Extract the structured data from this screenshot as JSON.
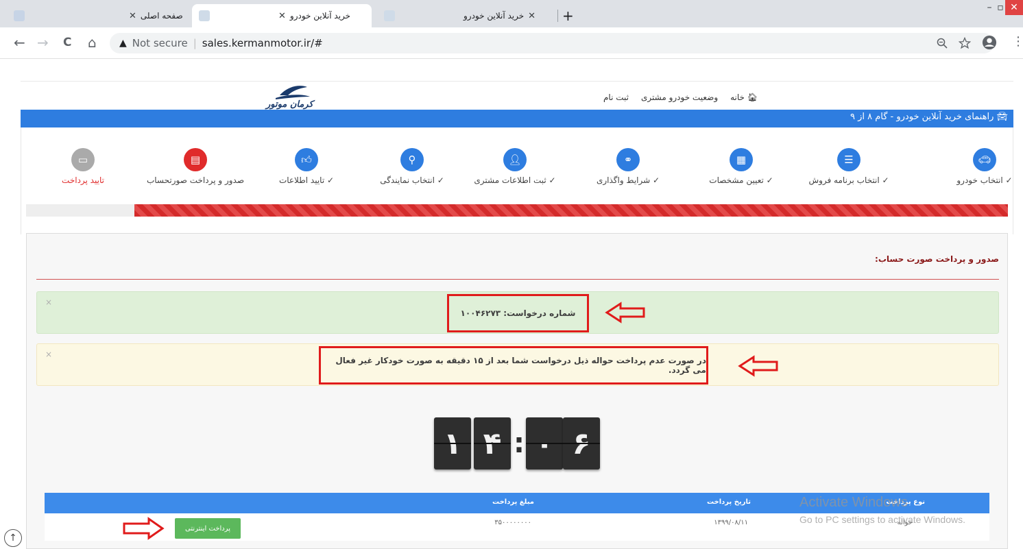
{
  "browser": {
    "tabs": [
      {
        "title": "صفحه اصلی",
        "active": false
      },
      {
        "title": "خرید آنلاین خودرو",
        "active": true
      },
      {
        "title": "خرید آنلاین خودرو",
        "active": false
      }
    ],
    "new_tab": "+",
    "close_glyph": "✕",
    "window_controls": {
      "minimize": "–",
      "maximize": "▫",
      "close": "✕"
    },
    "nav": {
      "back": "←",
      "forward": "→",
      "reload": "C",
      "home": "⌂"
    },
    "security_label": "Not secure",
    "url": "sales.kermanmotor.ir/#",
    "zoom_icon": "zoom-icon",
    "star_icon": "star-icon",
    "profile_icon": "account-icon",
    "menu_icon": "⋮"
  },
  "site": {
    "logo_text": "کرمان موتور",
    "nav": [
      {
        "label": "خانه",
        "icon": "home-icon"
      },
      {
        "label": "وضعیت خودرو مشتری"
      },
      {
        "label": "ثبت نام"
      }
    ],
    "guide_strip": "راهنمای خرید آنلاین خودرو - گام ۸ از ۹"
  },
  "steps": [
    {
      "label": "انتخاب خودرو",
      "done": true,
      "icon": "car-icon",
      "color": "#2e7de0"
    },
    {
      "label": "انتخاب برنامه فروش",
      "done": true,
      "icon": "list-icon",
      "color": "#2e7de0"
    },
    {
      "label": "تعیین مشخصات",
      "done": true,
      "icon": "calculator-icon",
      "color": "#2e7de0"
    },
    {
      "label": "شرایط واگذاری",
      "done": true,
      "icon": "handshake-icon",
      "color": "#2e7de0"
    },
    {
      "label": "ثبت اطلاعات مشتری",
      "done": true,
      "icon": "user-plus-icon",
      "color": "#2e7de0"
    },
    {
      "label": "انتخاب نمایندگی",
      "done": true,
      "icon": "location-icon",
      "color": "#2e7de0"
    },
    {
      "label": "تایید اطلاعات",
      "done": true,
      "icon": "thumbs-up-icon",
      "color": "#2e7de0"
    },
    {
      "label": "صدور و پرداخت صورتحساب",
      "done": false,
      "icon": "invoice-icon",
      "color": "#e02b2b"
    },
    {
      "label": "تایید پرداخت",
      "done": false,
      "icon": "credit-card-icon",
      "color": "#aaaaaa"
    }
  ],
  "progress": {
    "fraction": 0.89,
    "color": "#d42b2b"
  },
  "panel": {
    "title": "صدور و پرداخت صورت حساب:",
    "request_alert": "شماره درخواست: ۱۰۰۴۶۲۷۳",
    "warning_alert": "در صورت عدم پرداخت حواله ذیل درخواست شما بعد از ۱۵ دقیقه به صورت خودکار غیر فعال می گردد.",
    "dismiss": "×"
  },
  "timer": {
    "digits": [
      "۱",
      "۴",
      "۰",
      "۶"
    ],
    "separator": ":"
  },
  "table": {
    "headers": [
      "نوع پرداخت",
      "تاریخ پرداخت",
      "مبلغ پرداخت"
    ],
    "rows": [
      {
        "type": "حواله",
        "date": "۱۳۹۹/۰۸/۱۱",
        "amount": "۳۵۰۰۰۰۰۰۰۰"
      }
    ],
    "pay_button": "پرداخت اینترنتی"
  },
  "watermark": {
    "line1": "Activate Windows",
    "line2": "Go to PC settings to activate Windows."
  },
  "colors": {
    "accent_blue": "#2e7de0",
    "annotation_red": "#e01b1b",
    "success_green": "#5cb85c"
  }
}
